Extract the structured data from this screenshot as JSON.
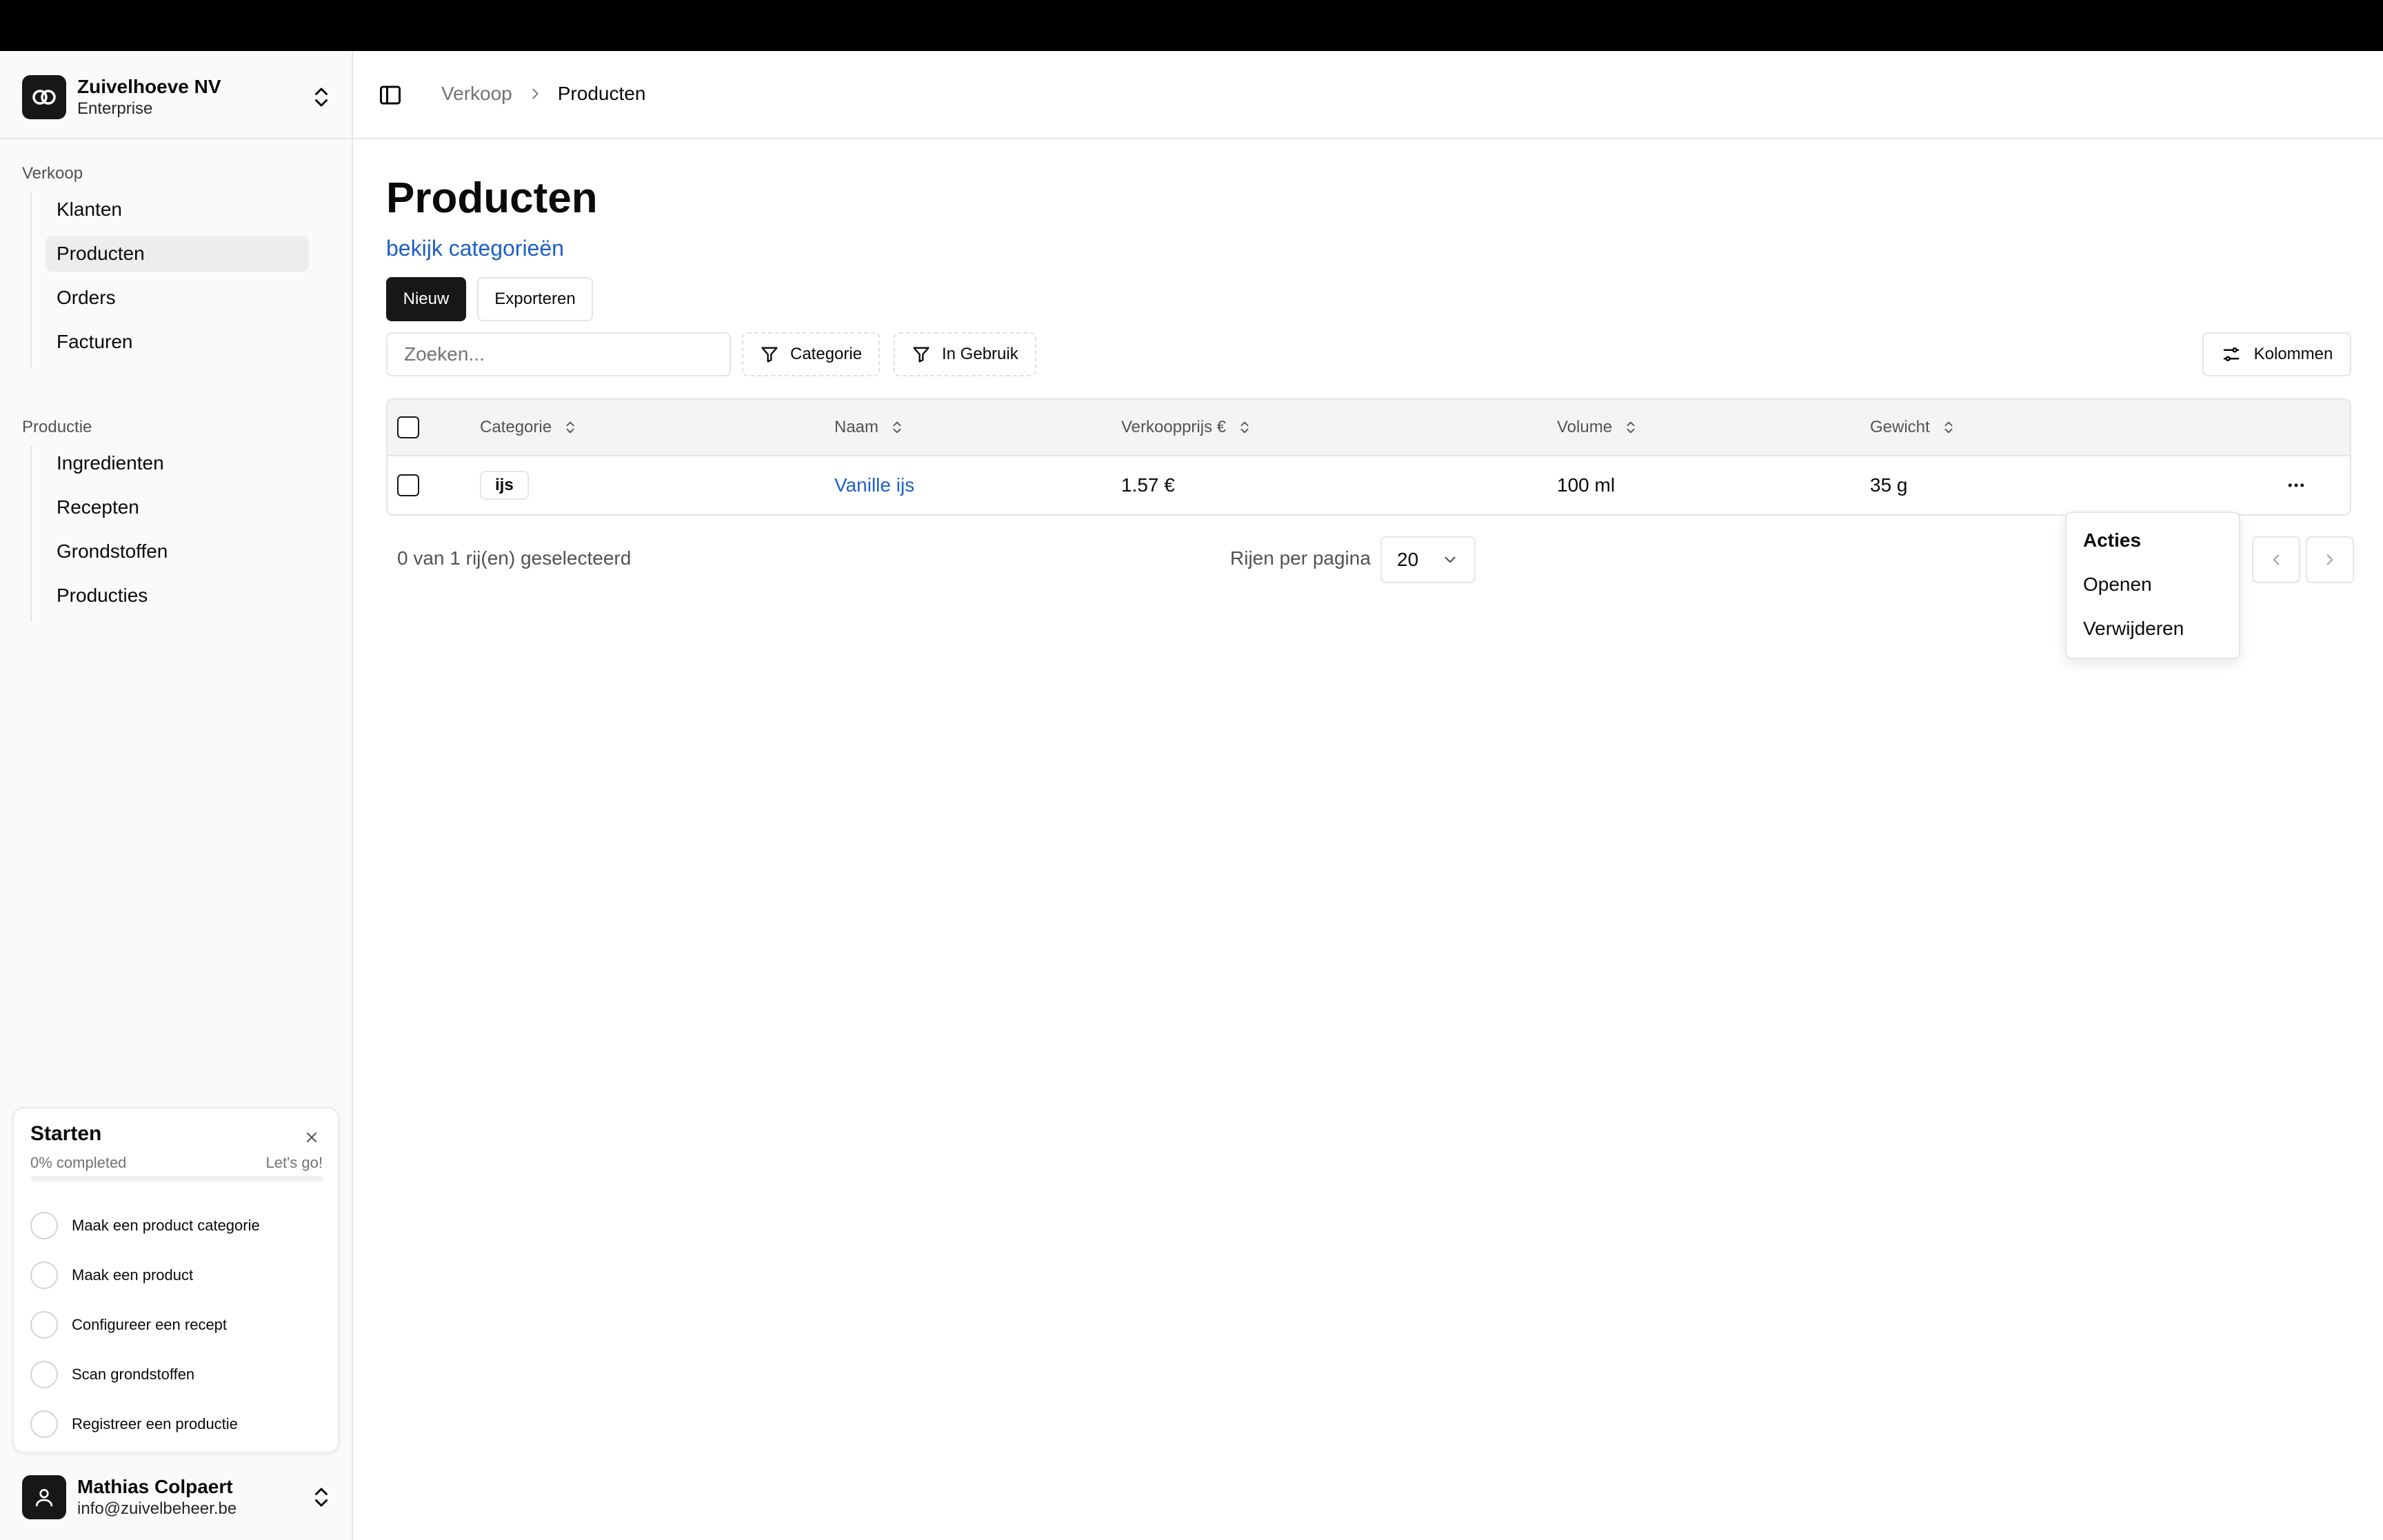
{
  "org": {
    "name": "Zuivelhoeve NV",
    "plan": "Enterprise"
  },
  "sidebar": {
    "groups": [
      {
        "label": "Verkoop",
        "items": [
          {
            "label": "Klanten"
          },
          {
            "label": "Producten",
            "active": true
          },
          {
            "label": "Orders"
          },
          {
            "label": "Facturen"
          }
        ]
      },
      {
        "label": "Productie",
        "items": [
          {
            "label": "Ingredienten"
          },
          {
            "label": "Recepten"
          },
          {
            "label": "Grondstoffen"
          },
          {
            "label": "Producties"
          }
        ]
      }
    ]
  },
  "onboarding": {
    "title": "Starten",
    "progress_text": "0% completed",
    "progress": 0,
    "cta": "Let's go!",
    "steps": [
      {
        "label": "Maak een product categorie"
      },
      {
        "label": "Maak een product"
      },
      {
        "label": "Configureer een recept"
      },
      {
        "label": "Scan grondstoffen"
      },
      {
        "label": "Registreer een productie"
      }
    ]
  },
  "user": {
    "name": "Mathias Colpaert",
    "email": "info@zuivelbeheer.be"
  },
  "breadcrumb": {
    "parent": "Verkoop",
    "current": "Producten"
  },
  "page": {
    "title": "Producten",
    "categories_link": "bekijk categorieën",
    "new_button": "Nieuw",
    "export_button": "Exporteren"
  },
  "toolbar": {
    "search_placeholder": "Zoeken...",
    "filter_category": "Categorie",
    "filter_in_use": "In Gebruik",
    "columns_button": "Kolommen"
  },
  "table": {
    "columns": [
      "Categorie",
      "Naam",
      "Verkoopprijs €",
      "Volume",
      "Gewicht"
    ],
    "rows": [
      {
        "category": "ijs",
        "name": "Vanille ijs",
        "price": "1.57 €",
        "volume": "100 ml",
        "weight": "35 g"
      }
    ]
  },
  "pagination": {
    "selection_info": "0 van 1 rij(en) geselecteerd",
    "rows_per_page_label": "Rijen per pagina",
    "rows_per_page": "20"
  },
  "actions_menu": {
    "label": "Acties",
    "items": [
      "Openen",
      "Verwijderen"
    ]
  },
  "colors": {
    "primary": "#171717",
    "link": "#1d5fc9",
    "border": "#e5e5e5",
    "sidebar_bg": "#fafafa"
  }
}
